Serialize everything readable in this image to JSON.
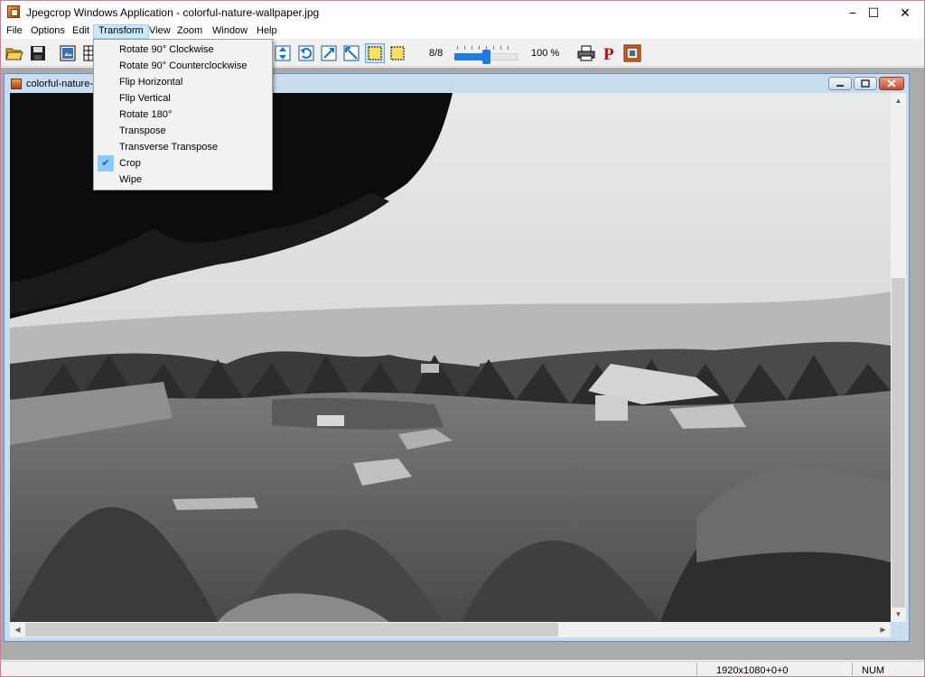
{
  "window": {
    "title": "Jpegcrop Windows Application - colorful-nature-wallpaper.jpg",
    "minimize_label": "−",
    "maximize_label": "☐",
    "close_label": "✕"
  },
  "menubar": {
    "items": [
      {
        "label": "File"
      },
      {
        "label": "Options"
      },
      {
        "label": "Edit"
      },
      {
        "label": "Transform"
      },
      {
        "label": "View"
      },
      {
        "label": "Zoom"
      },
      {
        "label": "Window"
      },
      {
        "label": "Help"
      }
    ],
    "active_item": "Transform"
  },
  "transform_menu": {
    "items": [
      {
        "label": "Rotate 90° Clockwise",
        "checked": false
      },
      {
        "label": "Rotate 90° Counterclockwise",
        "checked": false
      },
      {
        "label": "Flip Horizontal",
        "checked": false
      },
      {
        "label": "Flip Vertical",
        "checked": false
      },
      {
        "label": "Rotate 180°",
        "checked": false
      },
      {
        "label": "Transpose",
        "checked": false
      },
      {
        "label": "Transverse Transpose",
        "checked": false
      },
      {
        "label": "Crop",
        "checked": true
      },
      {
        "label": "Wipe",
        "checked": false
      }
    ],
    "check_mark": "✔"
  },
  "toolbar": {
    "scale_label": "8/8",
    "zoom_label": "100 %",
    "zoom_level_fraction": 0.5,
    "icons": [
      "open-icon",
      "save-icon",
      "properties-icon",
      "grid-icon",
      "flip-vertical-icon",
      "rotate-icon",
      "resize-icon",
      "transpose-icon",
      "crop-select-icon",
      "select-icon",
      "print-icon",
      "p-icon",
      "about-icon"
    ]
  },
  "child_window": {
    "title": "colorful-nature-v"
  },
  "statusbar": {
    "dimensions": "1920x1080+0+0",
    "num_lock": "NUM"
  },
  "colors": {
    "menu_highlight": "#cce8ff",
    "slider_accent": "#1f7be0",
    "mdi_background": "#ababab",
    "child_frame": "#c9ddf1"
  }
}
